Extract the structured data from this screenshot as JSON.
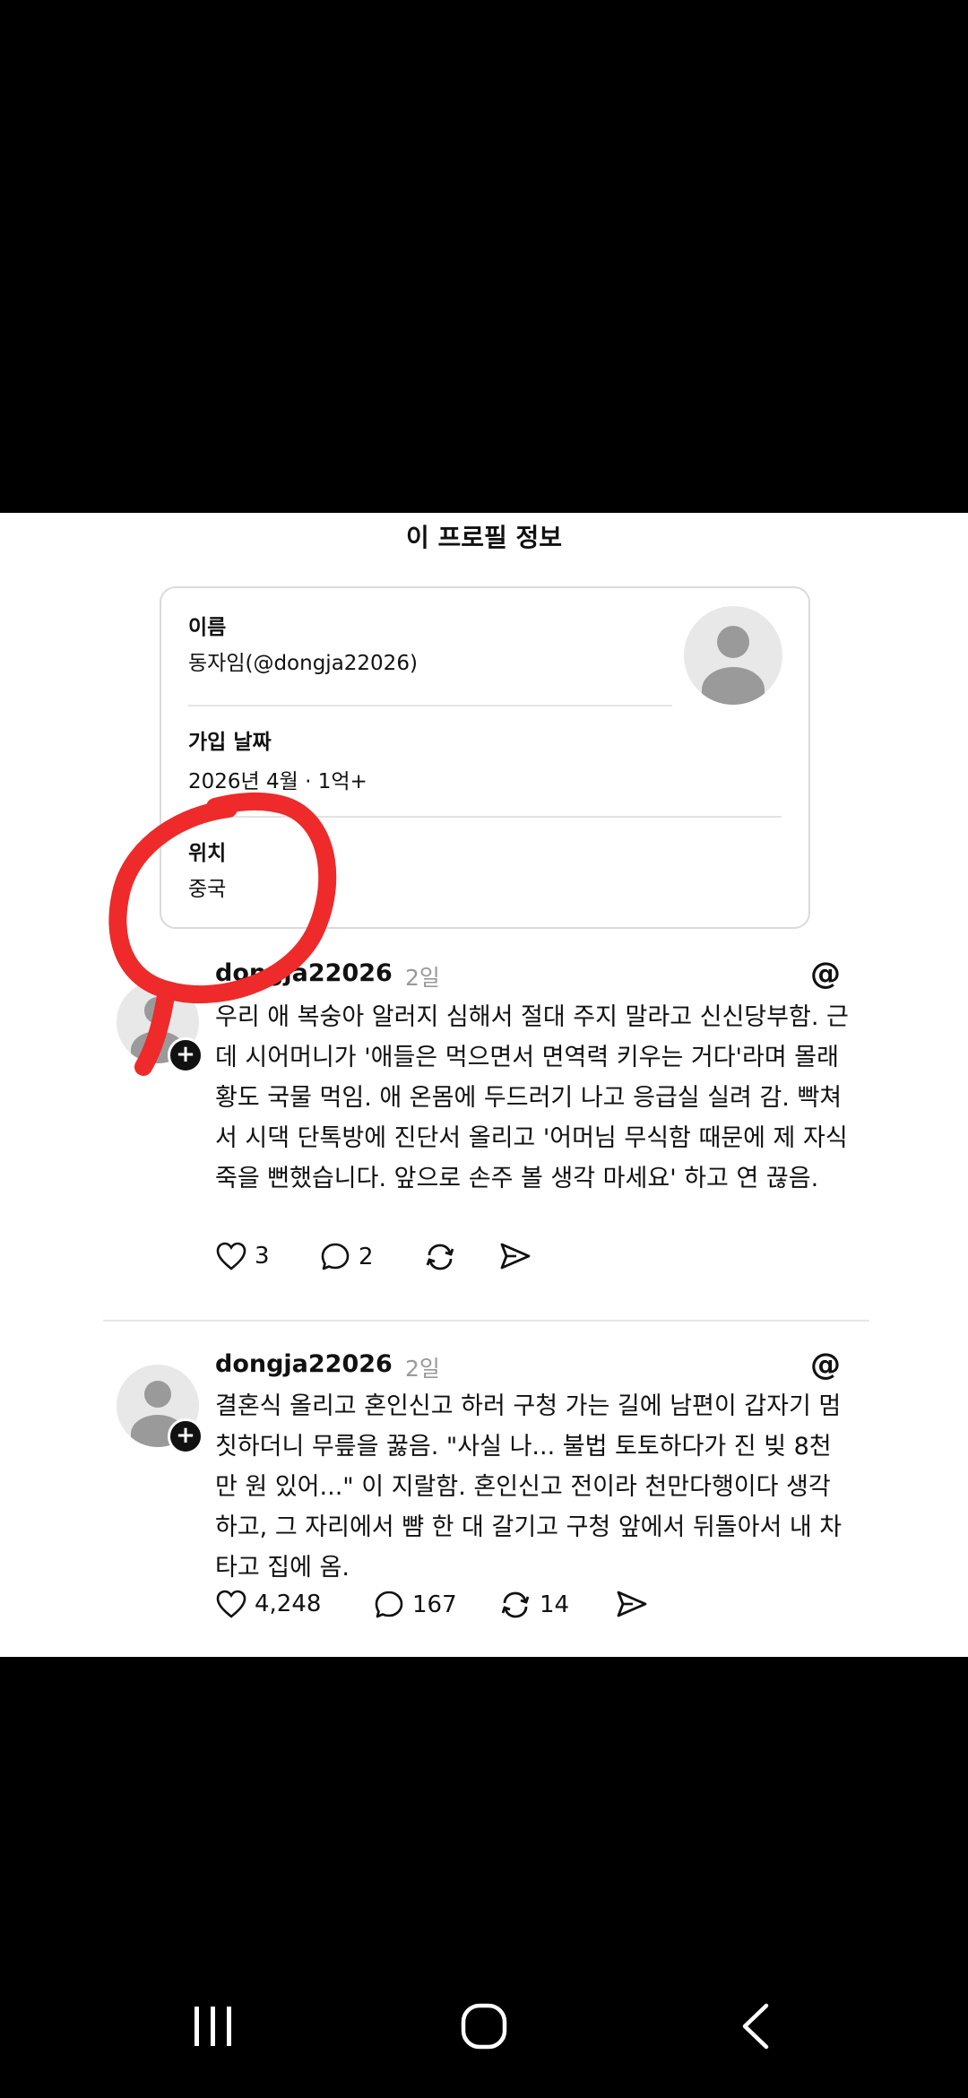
{
  "sheet": {
    "title": "이 프로필 정보"
  },
  "profile": {
    "name_label": "이름",
    "name_value": "동자임(@dongja22026)",
    "joined_label": "가입 날짜",
    "joined_value": "2026년 4월 · 1억+",
    "location_label": "위치",
    "location_value": "중국"
  },
  "posts": [
    {
      "username": "dongja22026",
      "time": "2일",
      "text": "우리 애 복숭아 알러지 심해서 절대 주지 말라고 신신당부함. 근데 시어머니가 '애들은 먹으면서 면역력 키우는 거다'라며 몰래 황도 국물 먹임. 애 온몸에 두드러기 나고 응급실 실려 감. 빡쳐서 시댁 단톡방에 진단서 올리고 '어머님 무식함 때문에 제 자식 죽을 뻔했습니다. 앞으로 손주 볼 생각 마세요' 하고 연 끊음.",
      "likes": "3",
      "replies": "2",
      "reposts": "",
      "shares": ""
    },
    {
      "username": "dongja22026",
      "time": "2일",
      "text": "결혼식 올리고 혼인신고 하러 구청 가는 길에 남편이 갑자기 멈칫하더니 무릎을 꿇음. \"사실 나... 불법 토토하다가 진 빚 8천만 원 있어...\" 이 지랄함. 혼인신고 전이라 천만다행이다 생각하고, 그 자리에서 뺨 한 대 갈기고 구청 앞에서 뒤돌아서 내 차 타고 집에 옴.",
      "likes": "4,248",
      "replies": "167",
      "reposts": "14",
      "shares": ""
    }
  ],
  "icons": {
    "threads": "threads-logo-icon",
    "like": "heart-icon",
    "reply": "comment-icon",
    "repost": "repost-icon",
    "share": "send-icon",
    "add": "plus-icon",
    "nav_recent": "recent-apps-icon",
    "nav_home": "home-icon",
    "nav_back": "back-icon"
  },
  "colors": {
    "background": "#000000",
    "card_border": "#dadada",
    "annotation": "#ee2a2a",
    "muted_text": "#999999"
  }
}
